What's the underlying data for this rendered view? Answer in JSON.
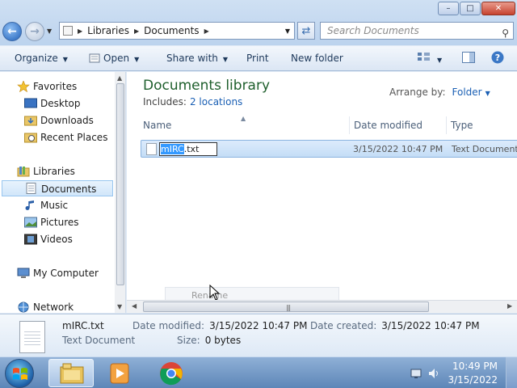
{
  "window": {
    "controls": {
      "minimize": "–",
      "maximize": "□",
      "close": "✕"
    }
  },
  "nav_buttons": {
    "back": "←",
    "forward": "→"
  },
  "address": {
    "segments": [
      "Libraries",
      "Documents"
    ]
  },
  "search": {
    "placeholder": "Search Documents"
  },
  "commands": {
    "organize": "Organize",
    "open": "Open",
    "share_with": "Share with",
    "print": "Print",
    "new_folder": "New folder"
  },
  "sidebar": {
    "favorites": {
      "header": "Favorites",
      "items": [
        "Desktop",
        "Downloads",
        "Recent Places"
      ]
    },
    "libraries": {
      "header": "Libraries",
      "items": [
        "Documents",
        "Music",
        "Pictures",
        "Videos"
      ],
      "selected": "Documents"
    },
    "computer": "My Computer",
    "network": "Network"
  },
  "library": {
    "title": "Documents library",
    "includes_label": "Includes:",
    "includes_link": "2 locations",
    "arrange_label": "Arrange by:",
    "arrange_value": "Folder"
  },
  "columns": [
    "Name",
    "Date modified",
    "Type"
  ],
  "files": [
    {
      "name_selected_part": "mIRC",
      "name_rest": ".txt",
      "date_modified": "3/15/2022 10:47 PM",
      "type": "Text Document"
    }
  ],
  "ghost_menu": {
    "label": "Rename"
  },
  "details": {
    "file_name": "mIRC.txt",
    "file_type": "Text Document",
    "date_modified_label": "Date modified:",
    "date_modified": "3/15/2022 10:47 PM",
    "date_created_label": "Date created:",
    "date_created": "3/15/2022 10:47 PM",
    "size_label": "Size:",
    "size": "0 bytes"
  },
  "taskbar": {
    "time": "10:49 PM",
    "date": "3/15/2022"
  },
  "colors": {
    "accent_link": "#1a5fb4",
    "library_title": "#1e5f2c",
    "selection": "#3399ff"
  }
}
